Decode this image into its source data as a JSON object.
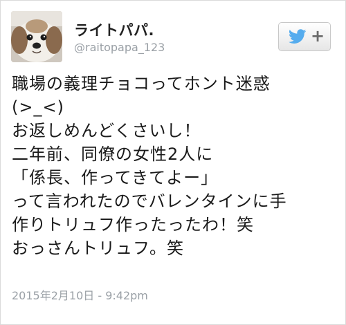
{
  "user": {
    "display_name": "ライトパパ.",
    "handle": "@raitopapa_123",
    "avatar_icon": "dog-avatar-icon"
  },
  "follow_button": {
    "icon": "twitter-bird-icon",
    "plus_label": "+",
    "accent_color": "#55acee"
  },
  "tweet": {
    "lines": [
      "職場の義理チョコってホント迷惑",
      "(>_<)",
      "お返しめんどくさいし！",
      "二年前、同僚の女性2人に",
      "「係長、作ってきてよー」",
      "って言われたのでバレンタインに手",
      "作りトリュフ作ったったわ！笑",
      "おっさんトリュフ。笑"
    ],
    "timestamp": "2015年2月10日 - 9:42pm"
  }
}
